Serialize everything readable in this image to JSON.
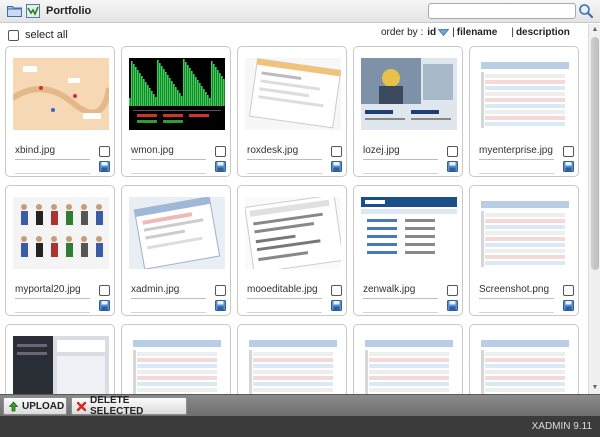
{
  "header": {
    "title": "Portfolio",
    "search": {
      "value": "",
      "placeholder": ""
    }
  },
  "toolbar": {
    "select_all_label": "select all",
    "order_prefix": "order by :",
    "order_active": "id",
    "order_options": [
      "filename",
      "description"
    ]
  },
  "files": [
    {
      "name": "xbind.jpg",
      "theme": "map"
    },
    {
      "name": "wmon.jpg",
      "theme": "graph"
    },
    {
      "name": "roxdesk.jpg",
      "theme": "desk"
    },
    {
      "name": "lozej.jpg",
      "theme": "worker"
    },
    {
      "name": "myenterprise.jpg",
      "theme": "table"
    },
    {
      "name": "myportal20.jpg",
      "theme": "people"
    },
    {
      "name": "xadmin.jpg",
      "theme": "dialog"
    },
    {
      "name": "mooeditable.jpg",
      "theme": "editor"
    },
    {
      "name": "zenwalk.jpg",
      "theme": "site"
    },
    {
      "name": "Screenshot.png",
      "theme": "table"
    },
    {
      "name": "",
      "theme": "dark"
    },
    {
      "name": "",
      "theme": "table"
    },
    {
      "name": "",
      "theme": "table"
    },
    {
      "name": "",
      "theme": "table"
    },
    {
      "name": "",
      "theme": "table"
    }
  ],
  "buttons": {
    "upload": "UPLOAD",
    "delete": "DELETE SELECTED"
  },
  "footer": {
    "version": "XADMIN 9.11"
  }
}
